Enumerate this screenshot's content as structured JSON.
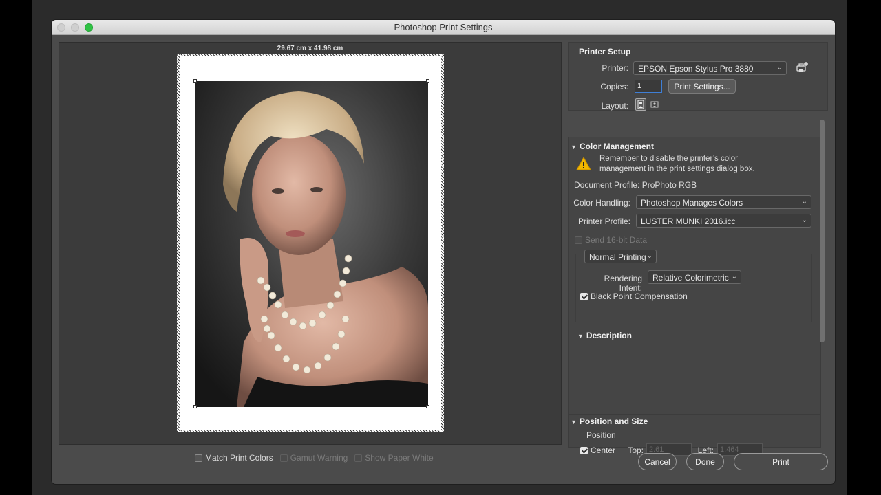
{
  "window": {
    "title": "Photoshop Print Settings"
  },
  "preview": {
    "paper_size": "29.67 cm x 41.98 cm",
    "photo_alt": "portrait of woman with pearl necklace"
  },
  "bottom_checks": [
    {
      "label": "Match Print Colors",
      "checked": false,
      "disabled": false
    },
    {
      "label": "Gamut Warning",
      "checked": false,
      "disabled": true
    },
    {
      "label": "Show Paper White",
      "checked": false,
      "disabled": true
    }
  ],
  "printer_setup": {
    "header": "Printer Setup",
    "printer_label": "Printer:",
    "printer_value": "EPSON Epson Stylus Pro 3880",
    "copies_label": "Copies:",
    "copies_value": "1",
    "print_settings_button": "Print Settings...",
    "layout_label": "Layout:"
  },
  "color_management": {
    "header": "Color Management",
    "warning_line1": "Remember to disable the printer’s color",
    "warning_line2": "management in the print settings dialog box.",
    "document_profile": "Document Profile: ProPhoto RGB",
    "color_handling_label": "Color Handling:",
    "color_handling_value": "Photoshop Manages Colors",
    "printer_profile_label": "Printer Profile:",
    "printer_profile_value": "LUSTER MUNKI 2016.icc",
    "send16bit_label": "Send 16-bit Data",
    "mode_value": "Normal Printing",
    "rendering_intent_label": "Rendering Intent:",
    "rendering_intent_value": "Relative Colorimetric",
    "bpc_label": "Black Point Compensation"
  },
  "description": {
    "header": "Description"
  },
  "position_size": {
    "header": "Position and Size",
    "position_label": "Position",
    "center_label": "Center",
    "top_label": "Top:",
    "top_value": "2.61",
    "left_label": "Left:",
    "left_value": "1.464"
  },
  "buttons": {
    "cancel": "Cancel",
    "done": "Done",
    "print": "Print"
  },
  "colors": {
    "accent_green": "#2fc244",
    "panel": "#4b4b4b",
    "warning": "#f2b600"
  }
}
